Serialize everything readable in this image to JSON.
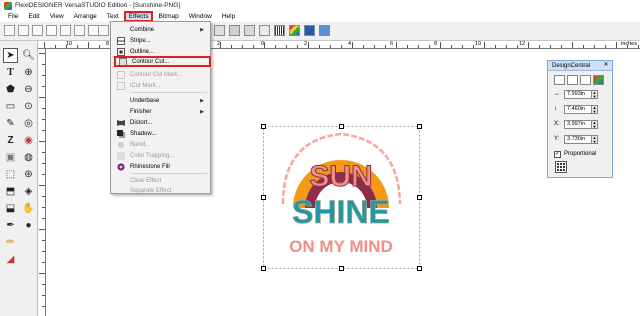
{
  "titlebar": {
    "title": "FlexiDESIGNER VersaSTUDIO Edition - [Sunshine-PNG]"
  },
  "menubar": {
    "items": [
      {
        "label": "File"
      },
      {
        "label": "Edit"
      },
      {
        "label": "View"
      },
      {
        "label": "Arrange"
      },
      {
        "label": "Text"
      },
      {
        "label": "Effects"
      },
      {
        "label": "Bitmap"
      },
      {
        "label": "Window"
      },
      {
        "label": "Help"
      }
    ]
  },
  "ruler": {
    "top_labels": [
      "10",
      "8",
      "6",
      "4",
      "2",
      "0",
      "2",
      "4",
      "6",
      "8",
      "10",
      "12"
    ],
    "units": "inches",
    "left_labels": [
      "2",
      "0",
      "2",
      "4",
      "6",
      "8",
      "10"
    ]
  },
  "effects_menu": {
    "items": [
      {
        "label": "Combine",
        "submenu": true,
        "disabled": false
      },
      {
        "label": "Stripe...",
        "disabled": false
      },
      {
        "label": "Outline...",
        "disabled": false
      },
      {
        "label": "Contour Cut...",
        "disabled": false,
        "highlighted": true
      },
      {
        "label": "Contour Cut Mark...",
        "disabled": true
      },
      {
        "label": "iCut Mark...",
        "disabled": true
      },
      {
        "label": "Underbase",
        "submenu": true,
        "disabled": false
      },
      {
        "label": "Finisher",
        "submenu": true,
        "disabled": false
      },
      {
        "label": "Distort...",
        "disabled": false
      },
      {
        "label": "Shadow...",
        "disabled": false
      },
      {
        "label": "Blend...",
        "disabled": true
      },
      {
        "label": "Color Trapping...",
        "disabled": true
      },
      {
        "label": "Rhinestone Fill",
        "disabled": false
      },
      {
        "label": "Clear Effect",
        "disabled": true
      },
      {
        "label": "Separate Effect",
        "disabled": true
      }
    ]
  },
  "artwork": {
    "line1": "SUN",
    "line2": "SHINE",
    "line3": "ON MY MIND"
  },
  "design_central": {
    "title": "DesignCentral",
    "width": "7.993in",
    "height": "7.460in",
    "x_label": "X:",
    "x": "3.997in",
    "y_label": "Y:",
    "y": "3.730in",
    "proportional_label": "Proportional",
    "proportional_checked": true
  },
  "colors": {
    "highlight_red": "#e02020",
    "orange": "#f39a12",
    "teal": "#1f97a6",
    "sage": "#8fa88a",
    "pink": "#f08f87",
    "maroon": "#8e2d4a"
  }
}
